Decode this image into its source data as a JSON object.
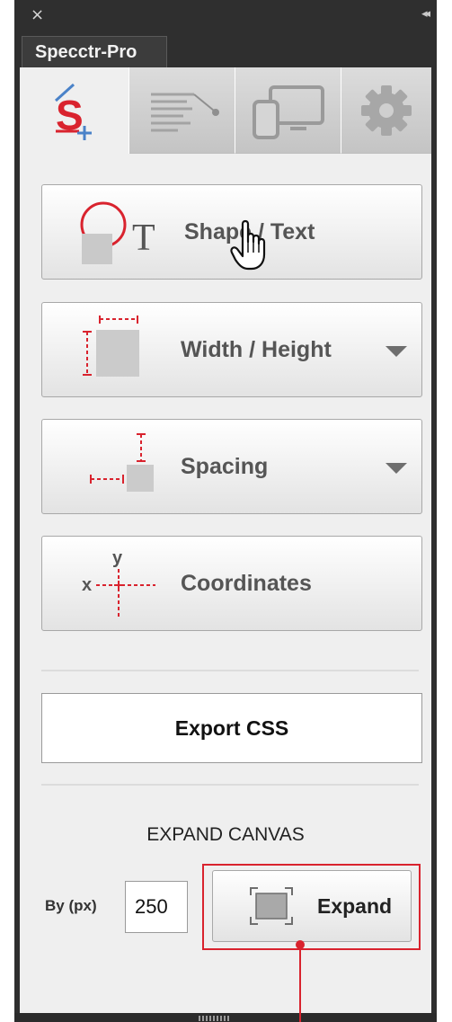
{
  "panel": {
    "tab_title": "Specctr-Pro",
    "close_symbol": "×",
    "collapse_symbol": "◂◂"
  },
  "tabs": [
    {
      "name": "specctr-logo-icon",
      "active": true
    },
    {
      "name": "text-spec-icon",
      "active": false
    },
    {
      "name": "responsive-devices-icon",
      "active": false
    },
    {
      "name": "gear-icon",
      "active": false
    }
  ],
  "tools": {
    "shape_text": "Shape / Text",
    "width_height": "Width / Height",
    "spacing": "Spacing",
    "coordinates": "Coordinates",
    "coord_x": "x",
    "coord_y": "y"
  },
  "export": {
    "label": "Export CSS"
  },
  "expand_canvas": {
    "title": "EXPAND CANVAS",
    "by_label": "By (px)",
    "value": "250",
    "button_label": "Expand"
  },
  "colors": {
    "accent_red": "#d9232e",
    "panel_dark": "#2f2f2f",
    "content_bg": "#efefef",
    "label_grey": "#555555"
  }
}
